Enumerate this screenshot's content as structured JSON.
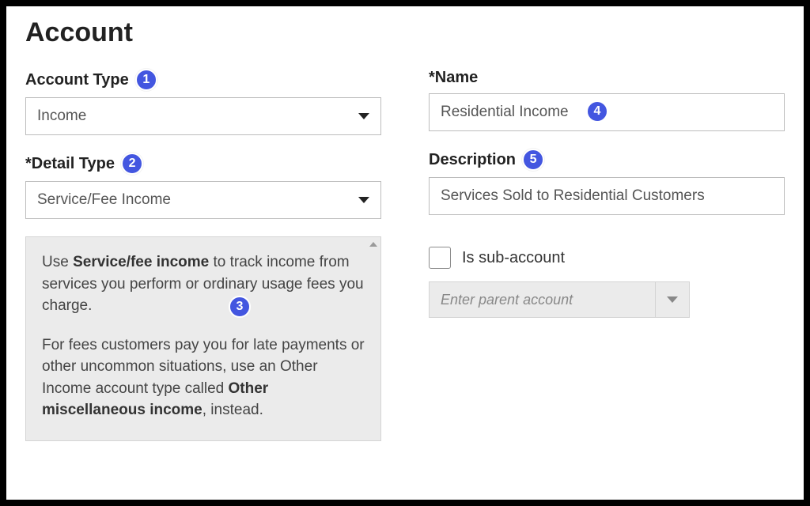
{
  "page": {
    "title": "Account"
  },
  "left": {
    "account_type": {
      "label": "Account Type",
      "value": "Income",
      "badge": "1"
    },
    "detail_type": {
      "label": "Detail Type",
      "value": "Service/Fee Income",
      "badge": "2"
    },
    "info": {
      "badge": "3",
      "p1_pre": "Use ",
      "p1_bold": "Service/fee income",
      "p1_post": " to track income from services you perform or ordinary usage fees you charge.",
      "p2_pre": "For fees customers pay you for late payments or other uncommon situations, use an Other Income account type called ",
      "p2_bold": "Other miscellaneous income",
      "p2_post": ", instead."
    }
  },
  "right": {
    "name": {
      "label": "Name",
      "value": "Residential Income",
      "badge": "4"
    },
    "description": {
      "label": "Description",
      "value": "Services Sold to Residential Customers",
      "badge": "5"
    },
    "sub_account": {
      "label": "Is sub-account",
      "parent_placeholder": "Enter parent account"
    }
  }
}
